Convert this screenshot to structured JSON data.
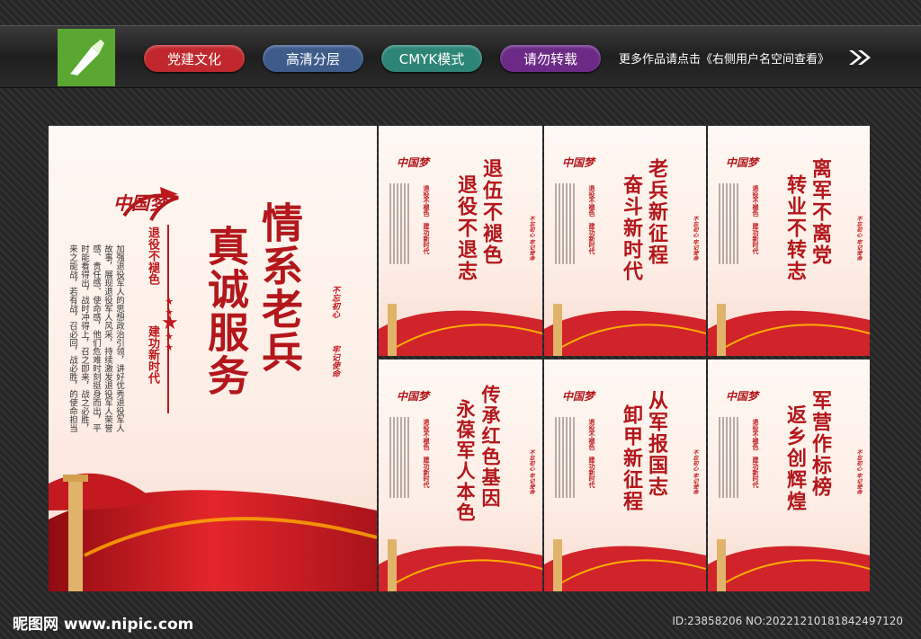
{
  "tags": [
    {
      "label": "党建文化",
      "color": "#c0282d"
    },
    {
      "label": "高清分层",
      "color": "#3e5b8a"
    },
    {
      "label": "CMYK模式",
      "color": "#2d8577"
    },
    {
      "label": "请勿转载",
      "color": "#6c2a86"
    }
  ],
  "more_text": "更多作品请点击《右侧用户名空间查看》",
  "main_poster": {
    "title_col1": "情系老兵",
    "title_col2": "真诚服务",
    "brand": "中国梦",
    "sub1": "退役不褪色",
    "sub2": "建功新时代",
    "body": "加强退役军人的思想政治引领，讲好优秀退役军人故事，展现退役军人风采，持续激发退役军人荣誉感、责任感、使命感，他们危难时刻挺身而出，平时能看得出，战时冲得上，召之即来，战之必胜，来之能战，若有战，召必回，战必胜，的使命担当",
    "seal1": "不忘初心",
    "seal2": "牢记使命"
  },
  "small_posters": [
    {
      "line1": "退伍不褪色",
      "line2": "退役不退志",
      "sub1": "退役不褪色",
      "sub2": "建功新时代",
      "seal": "不忘初心 牢记使命"
    },
    {
      "line1": "老兵新征程",
      "line2": "奋斗新时代",
      "sub1": "退役不褪色",
      "sub2": "建功新时代",
      "seal": "不忘初心 牢记使命"
    },
    {
      "line1": "离军不离党",
      "line2": "转业不转志",
      "sub1": "退役不褪色",
      "sub2": "建功新时代",
      "seal": "不忘初心 牢记使命"
    },
    {
      "line1": "传承红色基因",
      "line2": "永葆军人本色",
      "sub1": "退役不褪色",
      "sub2": "建功新时代",
      "seal": "不忘初心 牢记使命"
    },
    {
      "line1": "从军报国志",
      "line2": "卸甲新征程",
      "sub1": "退役不褪色",
      "sub2": "建功新时代",
      "seal": "不忘初心 牢记使命"
    },
    {
      "line1": "军营作标榜",
      "line2": "返乡创辉煌",
      "sub1": "退役不褪色",
      "sub2": "建功新时代",
      "seal": "不忘初心 牢记使命"
    }
  ],
  "footer": {
    "site": "昵图网 www.nipic.com",
    "id": "ID:23858206 NO:20221210181842497120"
  }
}
